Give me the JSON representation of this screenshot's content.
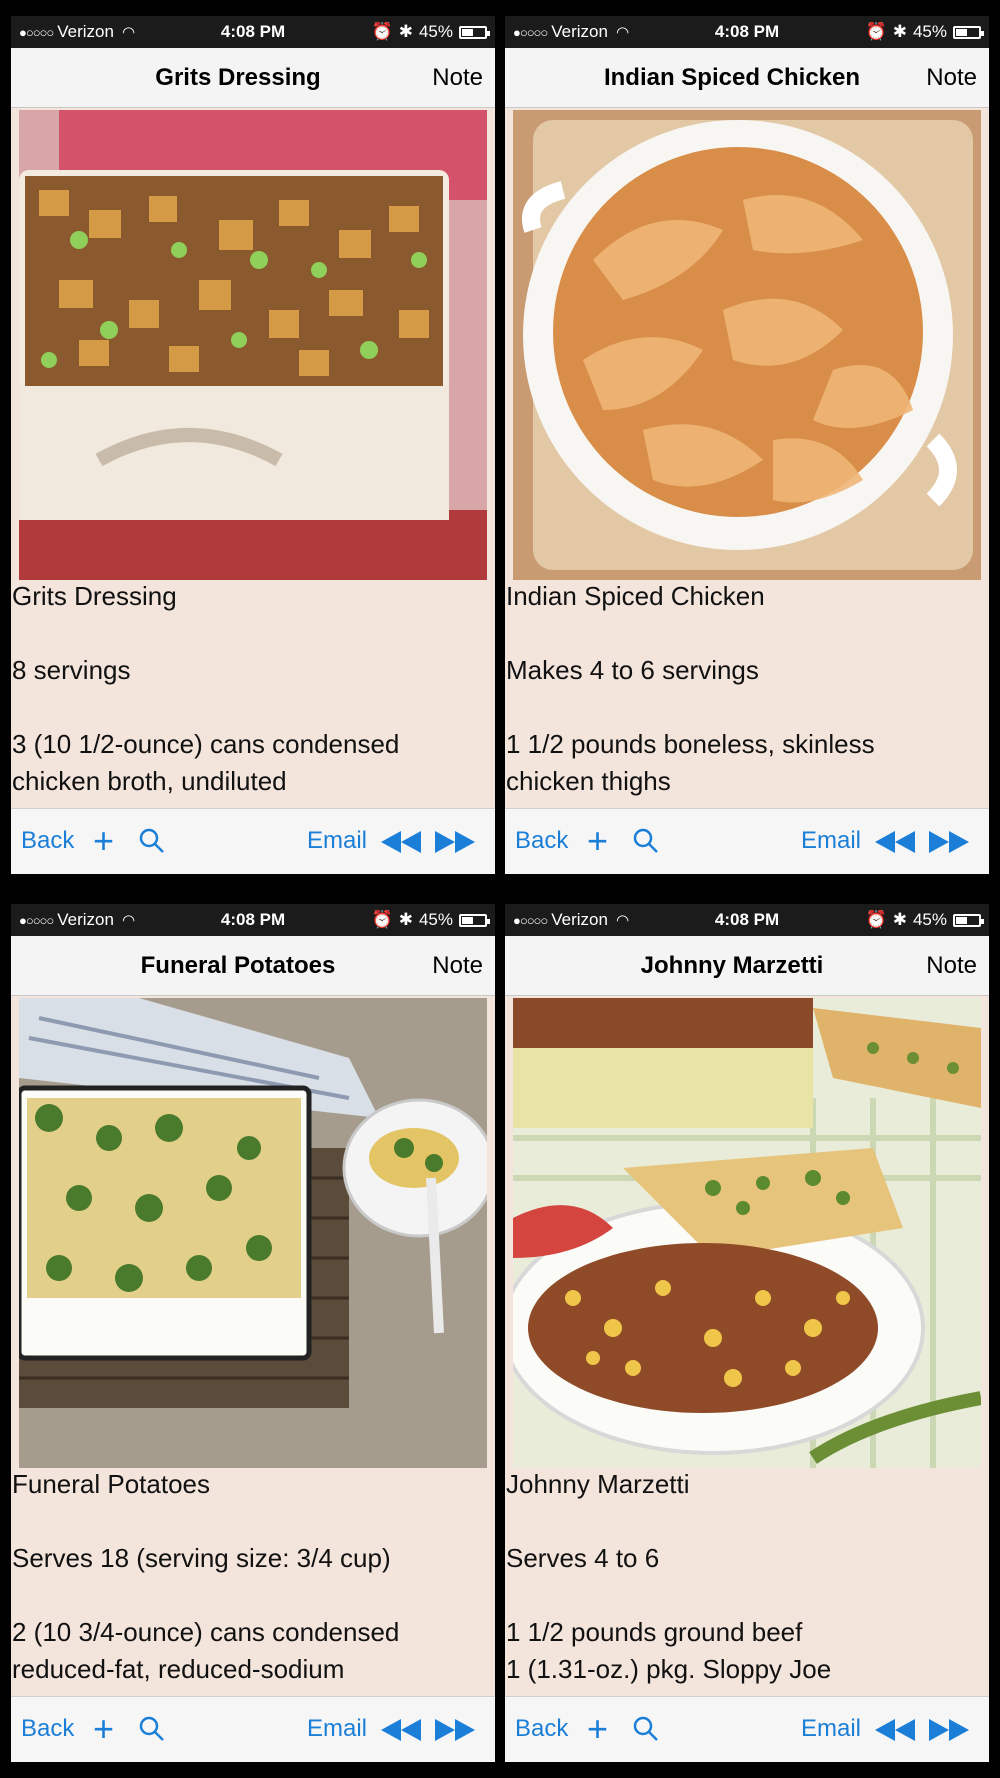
{
  "screens": [
    {
      "status": {
        "carrier": "Verizon",
        "time": "4:08 PM",
        "battery": "45%",
        "battery_level": 0.45
      },
      "nav": {
        "title": "Grits Dressing",
        "note": "Note"
      },
      "recipe": {
        "title": "Grits Dressing",
        "servings": "8 servings",
        "line1": "3 (10 1/2-ounce) cans condensed",
        "line2": "chicken broth, undiluted"
      },
      "toolbar": {
        "back": "Back",
        "email": "Email"
      }
    },
    {
      "status": {
        "carrier": "Verizon",
        "time": "4:08 PM",
        "battery": "45%",
        "battery_level": 0.45
      },
      "nav": {
        "title": "Indian Spiced Chicken",
        "note": "Note"
      },
      "recipe": {
        "title": "Indian Spiced Chicken",
        "servings": "Makes 4 to 6 servings",
        "line1": "1 1/2 pounds boneless, skinless",
        "line2": "chicken thighs"
      },
      "toolbar": {
        "back": "Back",
        "email": "Email"
      }
    },
    {
      "status": {
        "carrier": "Verizon",
        "time": "4:08 PM",
        "battery": "45%",
        "battery_level": 0.45
      },
      "nav": {
        "title": "Funeral Potatoes",
        "note": "Note"
      },
      "recipe": {
        "title": "Funeral Potatoes",
        "servings": "Serves 18 (serving size: 3/4 cup)",
        "line1": "2 (10 3/4-ounce) cans condensed",
        "line2": "reduced-fat, reduced-sodium"
      },
      "toolbar": {
        "back": "Back",
        "email": "Email"
      }
    },
    {
      "status": {
        "carrier": "Verizon",
        "time": "4:08 PM",
        "battery": "45%",
        "battery_level": 0.45
      },
      "nav": {
        "title": "Johnny Marzetti",
        "note": "Note"
      },
      "recipe": {
        "title": "Johnny Marzetti",
        "servings": "Serves 4 to 6",
        "line1": "1 1/2 pounds ground beef",
        "line2": "1 (1.31-oz.) pkg. Sloppy Joe"
      },
      "toolbar": {
        "back": "Back",
        "email": "Email"
      }
    }
  ],
  "colors": {
    "accent": "#1b7fd8",
    "page_background": "#f3e4dc",
    "status_bar": "#1b1b1b"
  }
}
